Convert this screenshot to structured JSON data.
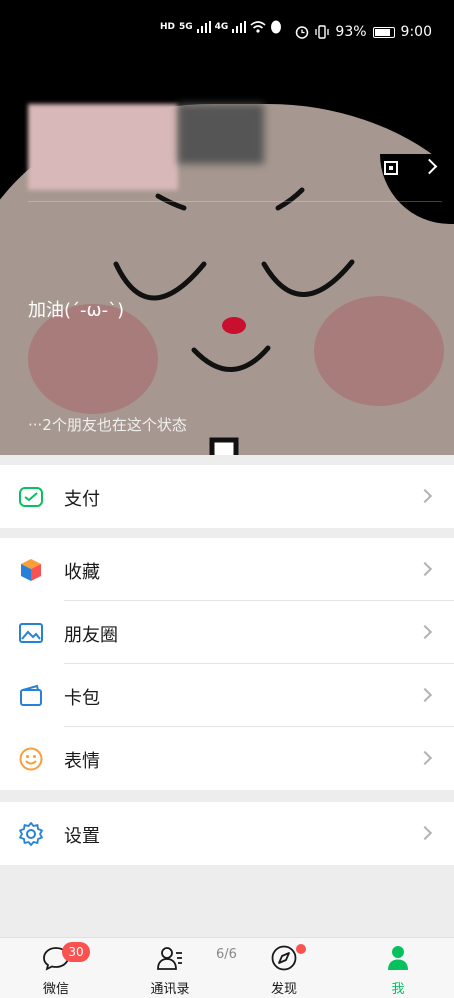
{
  "status_bar": {
    "network_labels": [
      "HD",
      "5G",
      "4G"
    ],
    "battery": "93%",
    "time": "9:00"
  },
  "profile": {
    "status_text": "加油(´-ω-`)",
    "friends_status": "···2个朋友也在这个状态"
  },
  "menu": {
    "pay": "支付",
    "favorites": "收藏",
    "moments": "朋友圈",
    "cards": "卡包",
    "stickers": "表情",
    "settings": "设置"
  },
  "tabbar": {
    "chats": "微信",
    "chats_badge": "30",
    "contacts": "通讯录",
    "discover": "发现",
    "me": "我",
    "page_indicator": "6/6"
  },
  "colors": {
    "accent": "#07c160",
    "badge": "#fa5151",
    "background": "#ededed"
  }
}
